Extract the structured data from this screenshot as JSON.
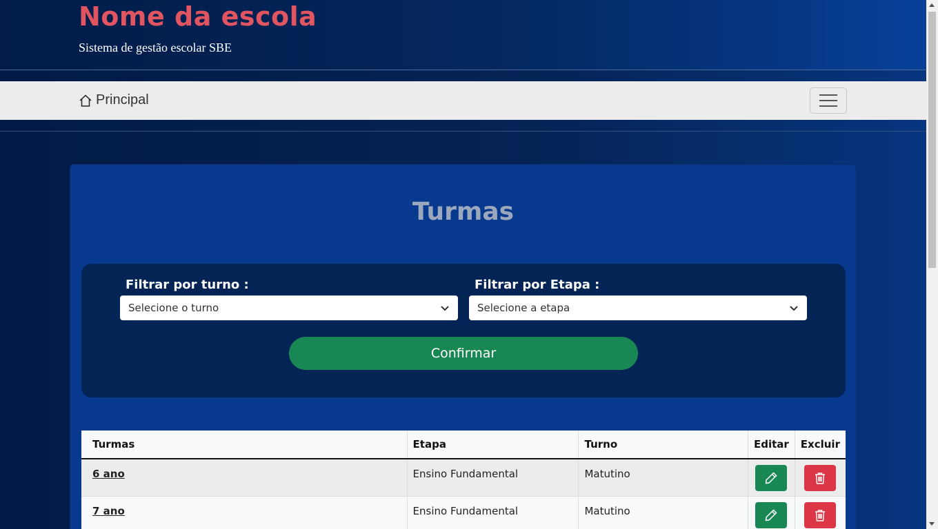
{
  "header": {
    "school_name": "Nome da escola",
    "system_name": "Sistema de gestão escolar SBE"
  },
  "navbar": {
    "home_label": "Principal",
    "home_icon": "house-icon",
    "menu_icon": "hamburger-menu-icon"
  },
  "main": {
    "title": "Turmas",
    "filters": {
      "turno_label": "Filtrar por turno :",
      "turno_value": "Selecione o turno",
      "etapa_label": "Filtrar por Etapa :",
      "etapa_value": "Selecione a etapa",
      "confirm_label": "Confirmar"
    },
    "table": {
      "headers": [
        "Turmas",
        "Etapa",
        "Turno",
        "Editar",
        "Excluir"
      ],
      "rows": [
        {
          "turma": "6 ano",
          "etapa": "Ensino Fundamental",
          "turno": "Matutino"
        },
        {
          "turma": "7 ano",
          "etapa": "Ensino Fundamental",
          "turno": "Matutino"
        }
      ]
    }
  },
  "colors": {
    "school_name": "#e05560",
    "confirm": "#198754",
    "edit": "#198754",
    "delete": "#dc3545",
    "card": "#073a8e",
    "filter_box": "#052456"
  }
}
